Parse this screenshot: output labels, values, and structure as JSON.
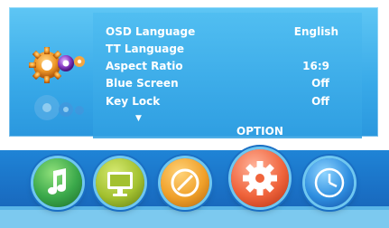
{
  "menu": {
    "rows": [
      {
        "label": "OSD Language",
        "value": "English"
      },
      {
        "label": "TT Language",
        "value": ""
      },
      {
        "label": "Aspect Ratio",
        "value": "16:9"
      },
      {
        "label": "Blue Screen",
        "value": "Off"
      },
      {
        "label": "Key Lock",
        "value": "Off"
      }
    ],
    "scroll_glyph": "▼",
    "current_page_label": "OPTION"
  },
  "dock": {
    "items": [
      {
        "name": "audio",
        "icon": "music-note-icon"
      },
      {
        "name": "picture",
        "icon": "monitor-icon"
      },
      {
        "name": "time",
        "icon": "dial-icon"
      },
      {
        "name": "option",
        "icon": "gear-icon",
        "selected": true
      },
      {
        "name": "clock",
        "icon": "clock-icon"
      }
    ]
  },
  "colors": {
    "panel": "#38a9e8",
    "dock": "#1a6fc4",
    "text": "#ffffff"
  }
}
